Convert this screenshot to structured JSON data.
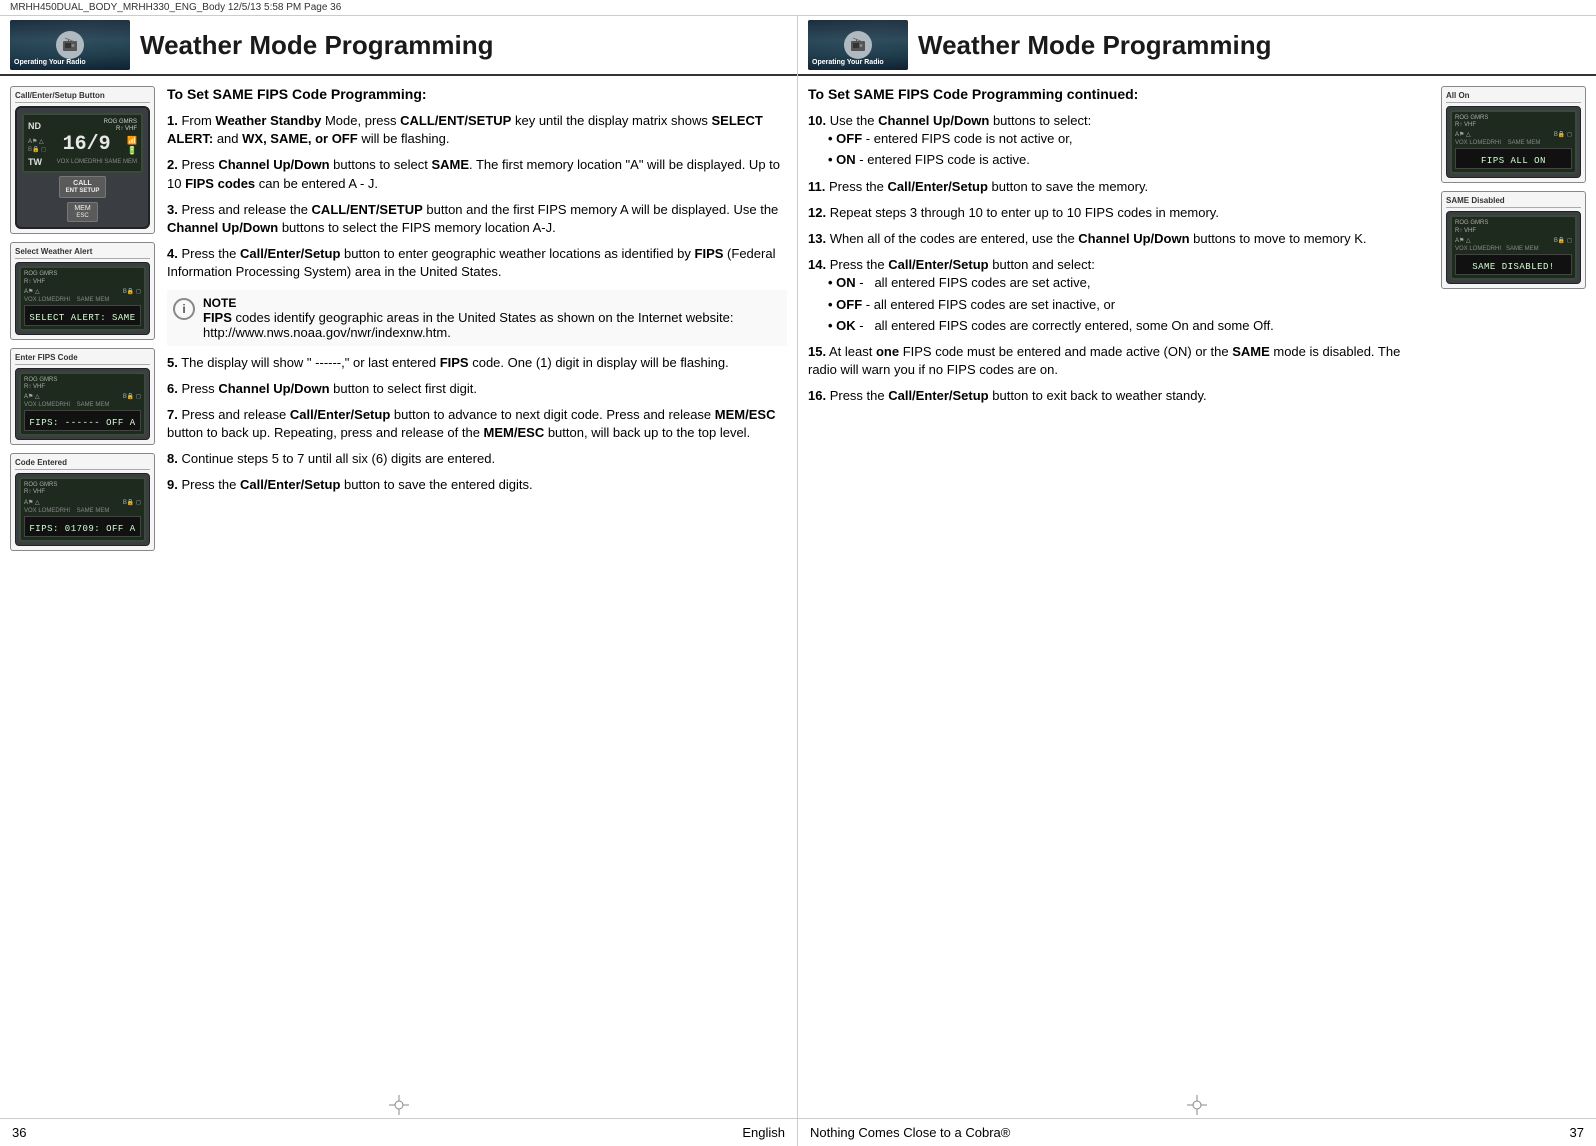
{
  "filebar": {
    "left": "MRHH450DUAL_BODY_MRHH330_ENG_Body  12/5/13  5:58 PM  Page 36"
  },
  "left_page": {
    "header": {
      "operating_label": "Operating Your Radio",
      "title": "Weather Mode Programming"
    },
    "devices": [
      {
        "label": "Call/Enter/Setup Button",
        "channel": "16/9",
        "btn1": "CALL",
        "btn1sub": "ENT SETUP",
        "btn2": "MEM",
        "btn2sub": "ESC",
        "nd": "ND",
        "tw": "TW"
      },
      {
        "label": "Select Weather Alert",
        "display": "SELECT ALERT: SAME"
      },
      {
        "label": "Enter FIPS Code",
        "display": "FIPS: ------  OFF A"
      },
      {
        "label": "Code Entered",
        "display": "FIPS: 01709: OFF A"
      }
    ],
    "title": "To Set SAME FIPS Code Programming:",
    "steps": [
      {
        "num": "1.",
        "text": "From Weather Standby Mode, press CALL/ENT/SETUP key until the display matrix shows SELECT ALERT: and WX, SAME, or OFF will be flashing."
      },
      {
        "num": "2.",
        "text": "Press Channel Up/Down buttons to select SAME. The first memory location \"A\" will be displayed. Up to 10 FIPS codes can be entered A - J."
      },
      {
        "num": "3.",
        "text": "Press and release the CALL/ENT/SETUP button and the first FIPS memory A will be displayed. Use the Channel Up/Down buttons to select the FIPS memory location A-J."
      },
      {
        "num": "4.",
        "text": "Press the Call/Enter/Setup button to enter geographic weather locations as identified by FIPS (Federal Information Processing System) area in the United States."
      },
      {
        "num": "5.",
        "text": "The display will show \" ------,\" or last entered FIPS code. One (1) digit in display will be flashing."
      },
      {
        "num": "6.",
        "text": "Press Channel Up/Down button to select first digit."
      },
      {
        "num": "7.",
        "text": "Press and release Call/Enter/Setup button to advance to next digit code. Press and release MEM/ESC button to back up. Repeating, press and release of the MEM/ESC button, will back up to the top level."
      },
      {
        "num": "8.",
        "text": "Continue steps 5 to 7 until all six (6) digits are entered."
      },
      {
        "num": "9.",
        "text": "Press the Call/Enter/Setup button to save the entered digits."
      }
    ],
    "note": {
      "title": "NOTE",
      "text": "FIPS codes identify geographic areas in the United States as shown on the Internet website: http://www.nws.noaa.gov/nwr/indexnw.htm."
    },
    "footer": {
      "page_num": "36",
      "lang": "English"
    }
  },
  "right_page": {
    "header": {
      "operating_label": "Operating Your Radio",
      "title": "Weather Mode Programming"
    },
    "devices": [
      {
        "label": "All On",
        "display": "FIPS ALL ON"
      },
      {
        "label": "SAME Disabled",
        "display": "SAME DISABLED!"
      }
    ],
    "title_continued": "To Set SAME FIPS Code Programming continued:",
    "steps": [
      {
        "num": "10.",
        "text": "Use the Channel Up/Down buttons to select:",
        "bullets": [
          "OFF - entered FIPS code is not active or,",
          "ON - entered FIPS code is active."
        ]
      },
      {
        "num": "11.",
        "text": "Press the Call/Enter/Setup button to save the memory."
      },
      {
        "num": "12.",
        "text": "Repeat steps 3 through 10 to enter up to 10 FIPS codes in memory."
      },
      {
        "num": "13.",
        "text": "When all of the codes are entered, use the Channel Up/Down buttons to move to memory K."
      },
      {
        "num": "14.",
        "text": "Press the Call/Enter/Setup button and select:",
        "bullets": [
          "ON -   all entered FIPS codes are set active,",
          "OFF - all entered FIPS codes are set inactive, or",
          "OK -   all entered FIPS codes are correctly entered, some On and some Off."
        ]
      },
      {
        "num": "15.",
        "text": "At least one FIPS code must be entered and made active (ON) or the SAME mode is disabled. The radio will warn you if no FIPS codes are on."
      },
      {
        "num": "16.",
        "text": "Press the Call/Enter/Setup button to exit back to weather standy."
      }
    ],
    "footer": {
      "page_num": "37",
      "text": "Nothing Comes Close to a Cobra®"
    }
  }
}
